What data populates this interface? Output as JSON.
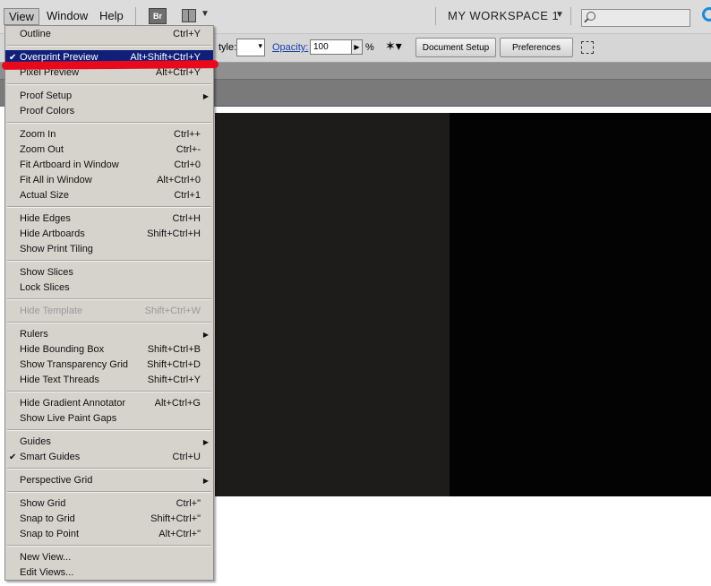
{
  "menubar": {
    "items": [
      "View",
      "Window",
      "Help"
    ],
    "bridge_label": "Br",
    "workspace_label": "MY WORKSPACE 1",
    "search_placeholder": ""
  },
  "control_bar": {
    "style_label": "tyle:",
    "opacity_label": "Opacity:",
    "opacity_value": "100",
    "percent": "%",
    "doc_setup": "Document Setup",
    "preferences": "Preferences"
  },
  "view_menu": {
    "items": [
      {
        "label": "Outline",
        "shortcut": "Ctrl+Y"
      },
      {
        "label": "Overprint Preview",
        "shortcut": "Alt+Shift+Ctrl+Y",
        "checked": true,
        "highlighted": true
      },
      {
        "label": "Pixel Preview",
        "shortcut": "Alt+Ctrl+Y"
      },
      {
        "label": "Proof Setup",
        "shortcut": "",
        "submenu": true
      },
      {
        "label": "Proof Colors",
        "shortcut": ""
      },
      {
        "label": "Zoom In",
        "shortcut": "Ctrl++"
      },
      {
        "label": "Zoom Out",
        "shortcut": "Ctrl+-"
      },
      {
        "label": "Fit Artboard in Window",
        "shortcut": "Ctrl+0"
      },
      {
        "label": "Fit All in Window",
        "shortcut": "Alt+Ctrl+0"
      },
      {
        "label": "Actual Size",
        "shortcut": "Ctrl+1"
      },
      {
        "label": "Hide Edges",
        "shortcut": "Ctrl+H"
      },
      {
        "label": "Hide Artboards",
        "shortcut": "Shift+Ctrl+H"
      },
      {
        "label": "Show Print Tiling",
        "shortcut": ""
      },
      {
        "label": "Show Slices",
        "shortcut": ""
      },
      {
        "label": "Lock Slices",
        "shortcut": ""
      },
      {
        "label": "Hide Template",
        "shortcut": "Shift+Ctrl+W",
        "disabled": true
      },
      {
        "label": "Rulers",
        "shortcut": "",
        "submenu": true
      },
      {
        "label": "Hide Bounding Box",
        "shortcut": "Shift+Ctrl+B"
      },
      {
        "label": "Show Transparency Grid",
        "shortcut": "Shift+Ctrl+D"
      },
      {
        "label": "Hide Text Threads",
        "shortcut": "Shift+Ctrl+Y"
      },
      {
        "label": "Hide Gradient Annotator",
        "shortcut": "Alt+Ctrl+G"
      },
      {
        "label": "Show Live Paint Gaps",
        "shortcut": ""
      },
      {
        "label": "Guides",
        "shortcut": "",
        "submenu": true
      },
      {
        "label": "Smart Guides",
        "shortcut": "Ctrl+U",
        "checked": true
      },
      {
        "label": "Perspective Grid",
        "shortcut": "",
        "submenu": true
      },
      {
        "label": "Show Grid",
        "shortcut": "Ctrl+\""
      },
      {
        "label": "Snap to Grid",
        "shortcut": "Shift+Ctrl+\""
      },
      {
        "label": "Snap to Point",
        "shortcut": "Alt+Ctrl+\""
      },
      {
        "label": "New View...",
        "shortcut": ""
      },
      {
        "label": "Edit Views...",
        "shortcut": ""
      }
    ]
  },
  "icons": {
    "check": "checkmark-icon",
    "submenu": "submenu-arrow-icon",
    "search": "search-icon",
    "workspace": "workspace-switcher-icon",
    "wand": "magic-wand-icon",
    "arrange": "arrange-documents-icon"
  },
  "colors": {
    "highlight": "#0f1f7a",
    "annotation": "#e8091d",
    "menu_bg": "#d6d3cd",
    "canvas_dark": "#1d1c1a",
    "canvas_black": "#030303"
  }
}
